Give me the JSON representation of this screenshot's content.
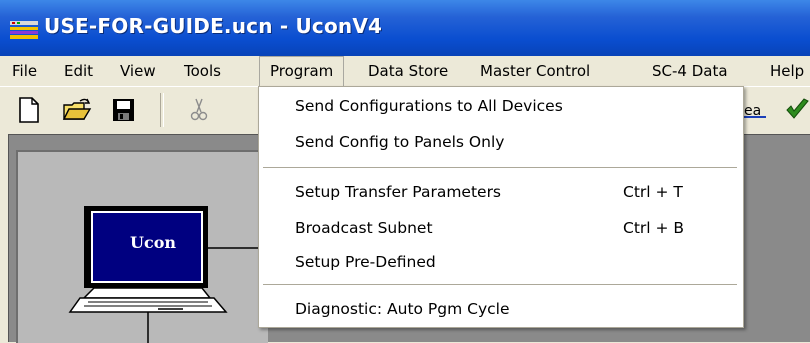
{
  "window": {
    "title": "USE-FOR-GUIDE.ucn - UconV4"
  },
  "menubar": {
    "items": [
      {
        "label": "File"
      },
      {
        "label": "Edit"
      },
      {
        "label": "View"
      },
      {
        "label": "Tools"
      },
      {
        "label": "Program"
      },
      {
        "label": "Data Store"
      },
      {
        "label": "Master Control"
      },
      {
        "label": "SC-4 Data"
      },
      {
        "label": "Help"
      }
    ]
  },
  "program_menu": {
    "send_all": "Send Configurations to All Devices",
    "send_panels": "Send Config to Panels Only",
    "setup_transfer": "Setup Transfer Parameters",
    "setup_transfer_shortcut": "Ctrl + T",
    "broadcast_subnet": "Broadcast Subnet",
    "broadcast_subnet_shortcut": "Ctrl + B",
    "setup_predefined": "Setup Pre-Defined",
    "diagnostic": "Diagnostic: Auto Pgm Cycle"
  },
  "toolbar": {
    "icons": [
      "new-file-icon",
      "open-folder-icon",
      "save-icon",
      "cut-icon",
      "network-icon",
      "check-icon"
    ],
    "partial_label": "ea"
  },
  "diagram": {
    "device_label": "Ucon"
  },
  "colors": {
    "titlebar": "#0a4ed0",
    "workspace": "#8a8a8a",
    "screen": "#000080"
  }
}
